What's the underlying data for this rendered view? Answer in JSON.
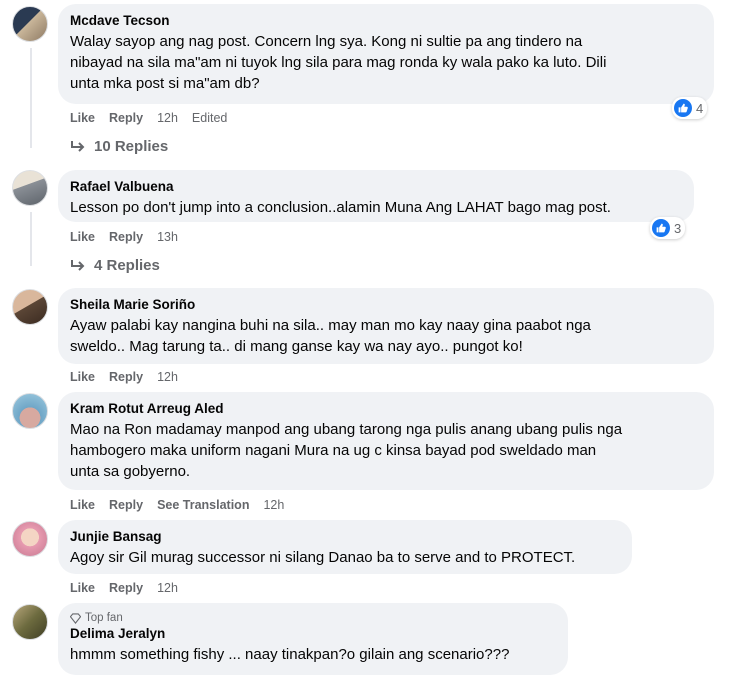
{
  "comments": [
    {
      "author": "Mcdave Tecson",
      "text": "Walay sayop ang nag post. Concern lng sya. Kong ni sultie pa ang tindero na\nnibayad na sila ma\"am ni tuyok lng sila para mag ronda ky wala pako ka luto. Dili\nunta mka post si ma\"am db?",
      "like": "Like",
      "reply": "Reply",
      "time": "12h",
      "edited": "Edited",
      "reactions": "4",
      "replies": "10 Replies",
      "avatar_colors": [
        "#2a3a52",
        "#c9b69a"
      ]
    },
    {
      "author": "Rafael Valbuena",
      "text": "Lesson po don't jump into a conclusion..alamin Muna Ang LAHAT bago mag post.",
      "like": "Like",
      "reply": "Reply",
      "time": "13h",
      "reactions": "3",
      "replies": "4 Replies",
      "avatar_colors": [
        "#8a8f96",
        "#e9e2d6"
      ]
    },
    {
      "author": "Sheila Marie Soriño",
      "text": "Ayaw palabi kay nangina buhi na sila.. may man mo kay naay gina paabot nga\nsweldo.. Mag tarung ta.. di mang ganse kay wa nay ayo.. pungot ko!",
      "like": "Like",
      "reply": "Reply",
      "time": "12h",
      "avatar_colors": [
        "#5b4636",
        "#d9b79c"
      ]
    },
    {
      "author": "Kram Rotut Arreug Aled",
      "text": "Mao na Ron madamay manpod ang ubang tarong nga pulis anang ubang pulis nga\nhambogero maka uniform nagani Mura na ug c kinsa bayad pod sweldado man\nunta sa gobyerno.",
      "like": "Like",
      "reply": "Reply",
      "see_translation": "See Translation",
      "time": "12h",
      "avatar_colors": [
        "#6fa6c7",
        "#d7a9a0"
      ]
    },
    {
      "author": "Junjie Bansag",
      "text": "Agoy sir Gil murag successor ni silang Danao ba to serve and to PROTECT.",
      "like": "Like",
      "reply": "Reply",
      "time": "12h",
      "avatar_colors": [
        "#e79bb0",
        "#f4d5c4"
      ]
    },
    {
      "top_fan": "Top fan",
      "author": "Delima Jeralyn",
      "text": "hmmm something fishy ... naay tinakpan?o gilain ang scenario???",
      "avatar_colors": [
        "#6c6a3e",
        "#b8a77c"
      ]
    }
  ],
  "colors": {
    "bubble": "#f0f2f5",
    "secondary_text": "#65676b",
    "like_blue": "#1877f2"
  }
}
